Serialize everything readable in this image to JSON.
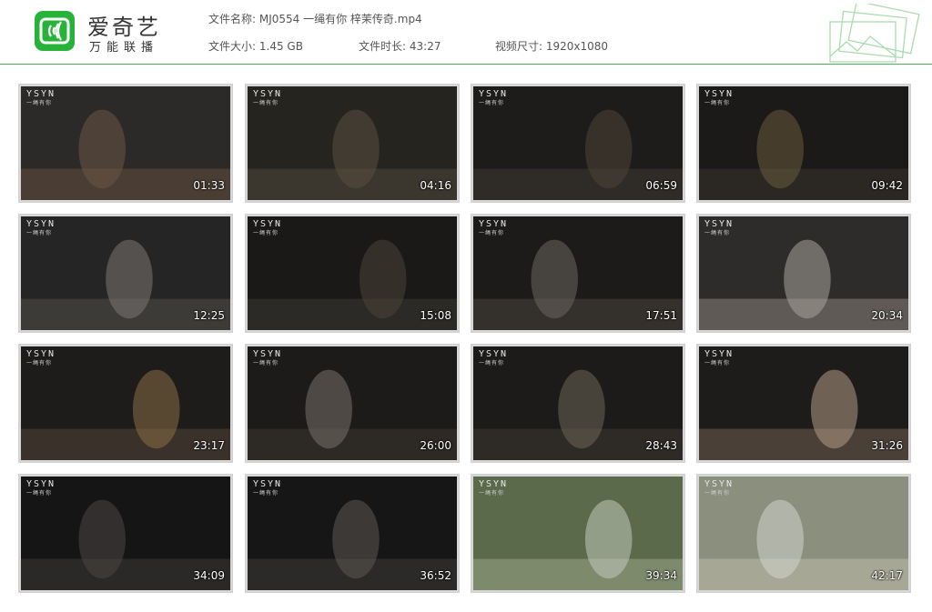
{
  "brand": {
    "name": "爱奇艺",
    "subtitle": "万能联播",
    "color": "#27b33a"
  },
  "file_info": {
    "name_label": "文件名称:",
    "name_value": "MJ0554 一绳有你 梓茉传奇.mp4",
    "size_label": "文件大小:",
    "size_value": "1.45 GB",
    "duration_label": "文件时长:",
    "duration_value": "43:27",
    "resolution_label": "视频尺寸:",
    "resolution_value": "1920x1080"
  },
  "watermark": {
    "logo": "YSYN",
    "sub": "一绳有你"
  },
  "thumbnails": [
    {
      "time": "01:33"
    },
    {
      "time": "04:16"
    },
    {
      "time": "06:59"
    },
    {
      "time": "09:42"
    },
    {
      "time": "12:25"
    },
    {
      "time": "15:08"
    },
    {
      "time": "17:51"
    },
    {
      "time": "20:34"
    },
    {
      "time": "23:17"
    },
    {
      "time": "26:00"
    },
    {
      "time": "28:43"
    },
    {
      "time": "31:26"
    },
    {
      "time": "34:09"
    },
    {
      "time": "36:52"
    },
    {
      "time": "39:34"
    },
    {
      "time": "42:17"
    }
  ]
}
